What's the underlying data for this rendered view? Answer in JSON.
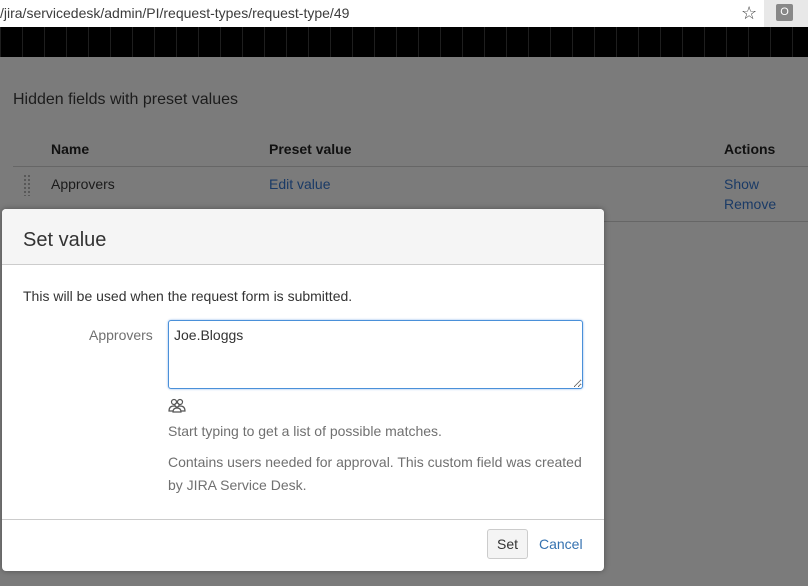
{
  "browser": {
    "url": "/jira/servicedesk/admin/PI/request-types/request-type/49",
    "star_icon": "star-icon",
    "extension_icon_glyph": "O"
  },
  "page": {
    "section_title": "Hidden fields with preset values",
    "table": {
      "headers": [
        "Name",
        "Preset value",
        "Actions"
      ],
      "rows": [
        {
          "name": "Approvers",
          "preset_link": "Edit value",
          "actions": [
            "Show",
            "Remove"
          ]
        }
      ]
    }
  },
  "dialog": {
    "title": "Set value",
    "intro": "This will be used when the request form is submitted.",
    "field": {
      "label": "Approvers",
      "value": "Joe.Bloggs",
      "icon": "user-group-icon",
      "help_primary": "Start typing to get a list of possible matches.",
      "help_secondary": "Contains users needed for approval. This custom field was created by JIRA Service Desk."
    },
    "buttons": {
      "set_label": "Set",
      "cancel_label": "Cancel"
    }
  },
  "colors": {
    "overlay": "#7b7b7b",
    "link": "#3572b0",
    "focus_border": "#4a90d9"
  }
}
